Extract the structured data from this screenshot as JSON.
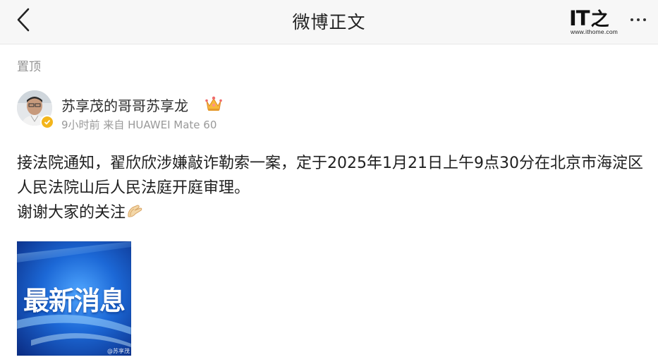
{
  "header": {
    "title": "微博正文",
    "logo_mark": "IT",
    "logo_han": "之",
    "logo_url": "www.ithome.com"
  },
  "post": {
    "pinned_label": "置顶",
    "author_name": "苏享茂的哥哥苏享龙",
    "time": "9小时前",
    "source": "来自 HUAWEI Mate 60",
    "text_line1": "接法院通知，翟欣欣涉嫌敲诈勒索一案，定于2025年1月21日上午9点30分在北京市海淀区人民法院山后人民法庭开庭审理。",
    "text_line2": "谢谢大家的关注",
    "image_text": "最新消息",
    "image_watermark": "@苏享茂"
  },
  "colors": {
    "header_bg": "#f7f7f7",
    "meta_gray": "#999999",
    "verify_gold": "#f3b51b",
    "image_blue": "#1b63c9"
  },
  "icons": {
    "back": "chevron-left-icon",
    "more": "more-dots-icon",
    "crown": "crown-icon",
    "verify": "verified-badge-icon",
    "clap": "clapping-hands-icon"
  }
}
